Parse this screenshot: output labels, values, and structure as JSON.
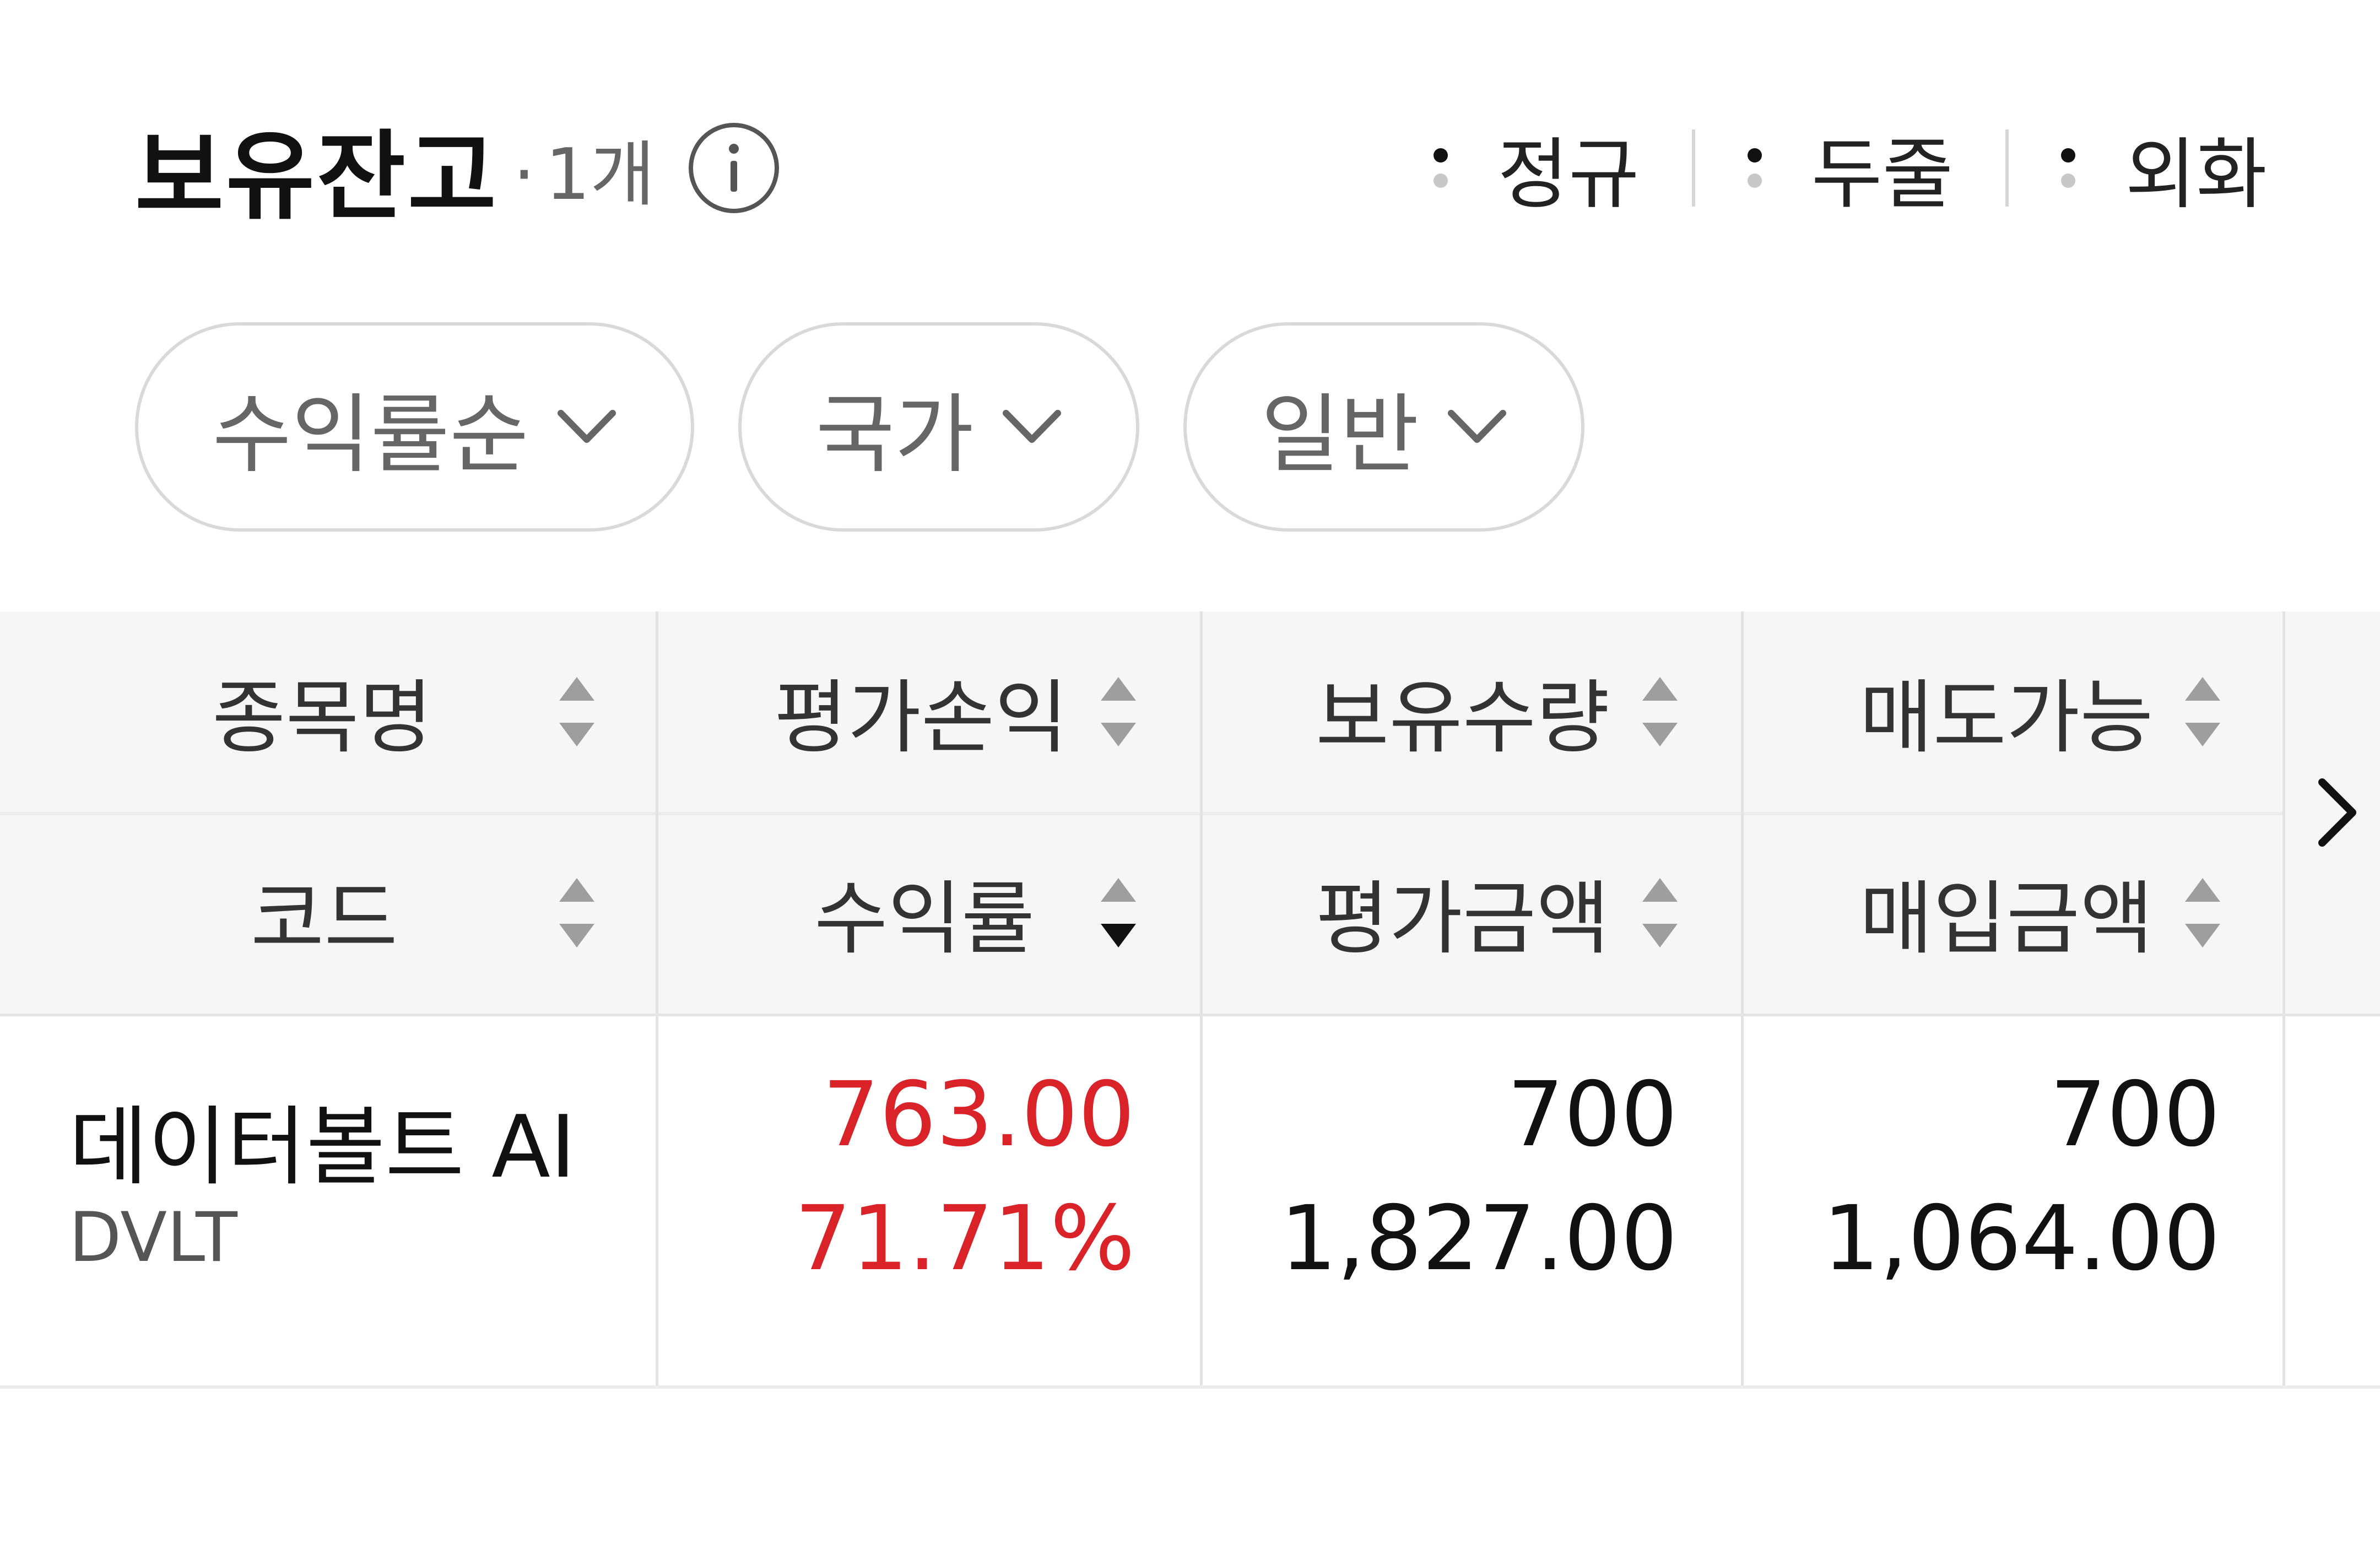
{
  "header": {
    "title": "보유잔고",
    "count_dot": "·",
    "count": "1개",
    "info_icon": "info-icon"
  },
  "market_filters": [
    {
      "label": "정규"
    },
    {
      "label": "두줄"
    },
    {
      "label": "외화"
    }
  ],
  "chips": [
    {
      "label": "수익률순",
      "icon": "chevron-down-icon"
    },
    {
      "label": "국가",
      "icon": "chevron-down-icon"
    },
    {
      "label": "일반",
      "icon": "chevron-down-icon"
    }
  ],
  "table": {
    "header_row1": [
      "종목명",
      "평가손익",
      "보유수량",
      "매도가능"
    ],
    "header_row2": [
      "코드",
      "수익률",
      "평가금액",
      "매입금액"
    ],
    "active_sort": {
      "column": "수익률",
      "direction": "desc"
    },
    "rows": [
      {
        "name": "데이터볼트 AI",
        "code": "DVLT",
        "pnl": "763.00",
        "return_rate": "71.71%",
        "quantity": "700",
        "eval_amount": "1,827.00",
        "sellable": "700",
        "purchase_amount": "1,064.00"
      }
    ]
  },
  "colors": {
    "profit": "#d92329",
    "header_bg": "#f6f6f6",
    "border": "#e3e3e3"
  }
}
